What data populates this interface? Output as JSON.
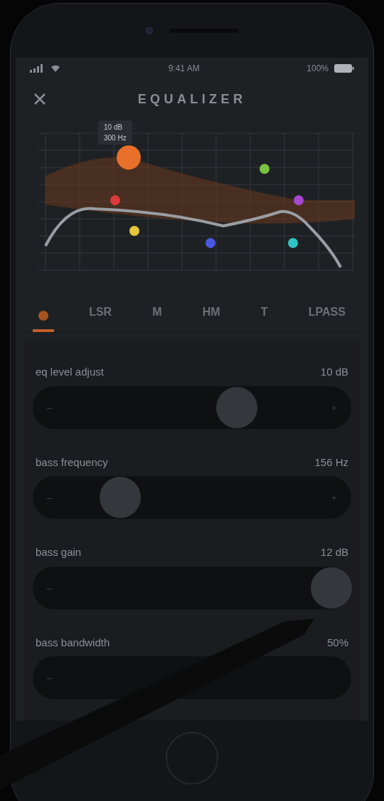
{
  "status_bar": {
    "time": "9:41 AM",
    "battery": "100%"
  },
  "header": {
    "title": "EQUALIZER"
  },
  "tooltip": {
    "gain": "10 dB",
    "frequency": "300 Hz"
  },
  "bands": [
    {
      "color": "#e8702a",
      "selected": true
    },
    {
      "color": "#d93a3a",
      "selected": false
    },
    {
      "color": "#e6c73a",
      "selected": false
    },
    {
      "color": "#4858e0",
      "selected": false
    },
    {
      "color": "#7cc241",
      "selected": false
    },
    {
      "color": "#2ec4c4",
      "selected": false
    },
    {
      "color": "#a648cf",
      "selected": false
    }
  ],
  "tabs": [
    {
      "kind": "dot",
      "selected": true
    },
    {
      "kind": "text",
      "label": "LSR",
      "selected": false
    },
    {
      "kind": "text",
      "label": "M",
      "selected": false
    },
    {
      "kind": "text",
      "label": "HM",
      "selected": false
    },
    {
      "kind": "text",
      "label": "T",
      "selected": false
    },
    {
      "kind": "text",
      "label": "LPASS",
      "selected": false
    }
  ],
  "sliders": [
    {
      "label": "eq level adjust",
      "reading": "10 dB",
      "level": 0.66,
      "min": "–",
      "max": "+"
    },
    {
      "label": "bass frequency",
      "reading": "156 Hz",
      "level": 0.24,
      "min": "–",
      "max": "+"
    },
    {
      "label": "bass gain",
      "reading": "12 dB",
      "level": 1,
      "min": "–"
    },
    {
      "label": "bass bandwidth",
      "reading": "50%",
      "min": "–"
    }
  ]
}
